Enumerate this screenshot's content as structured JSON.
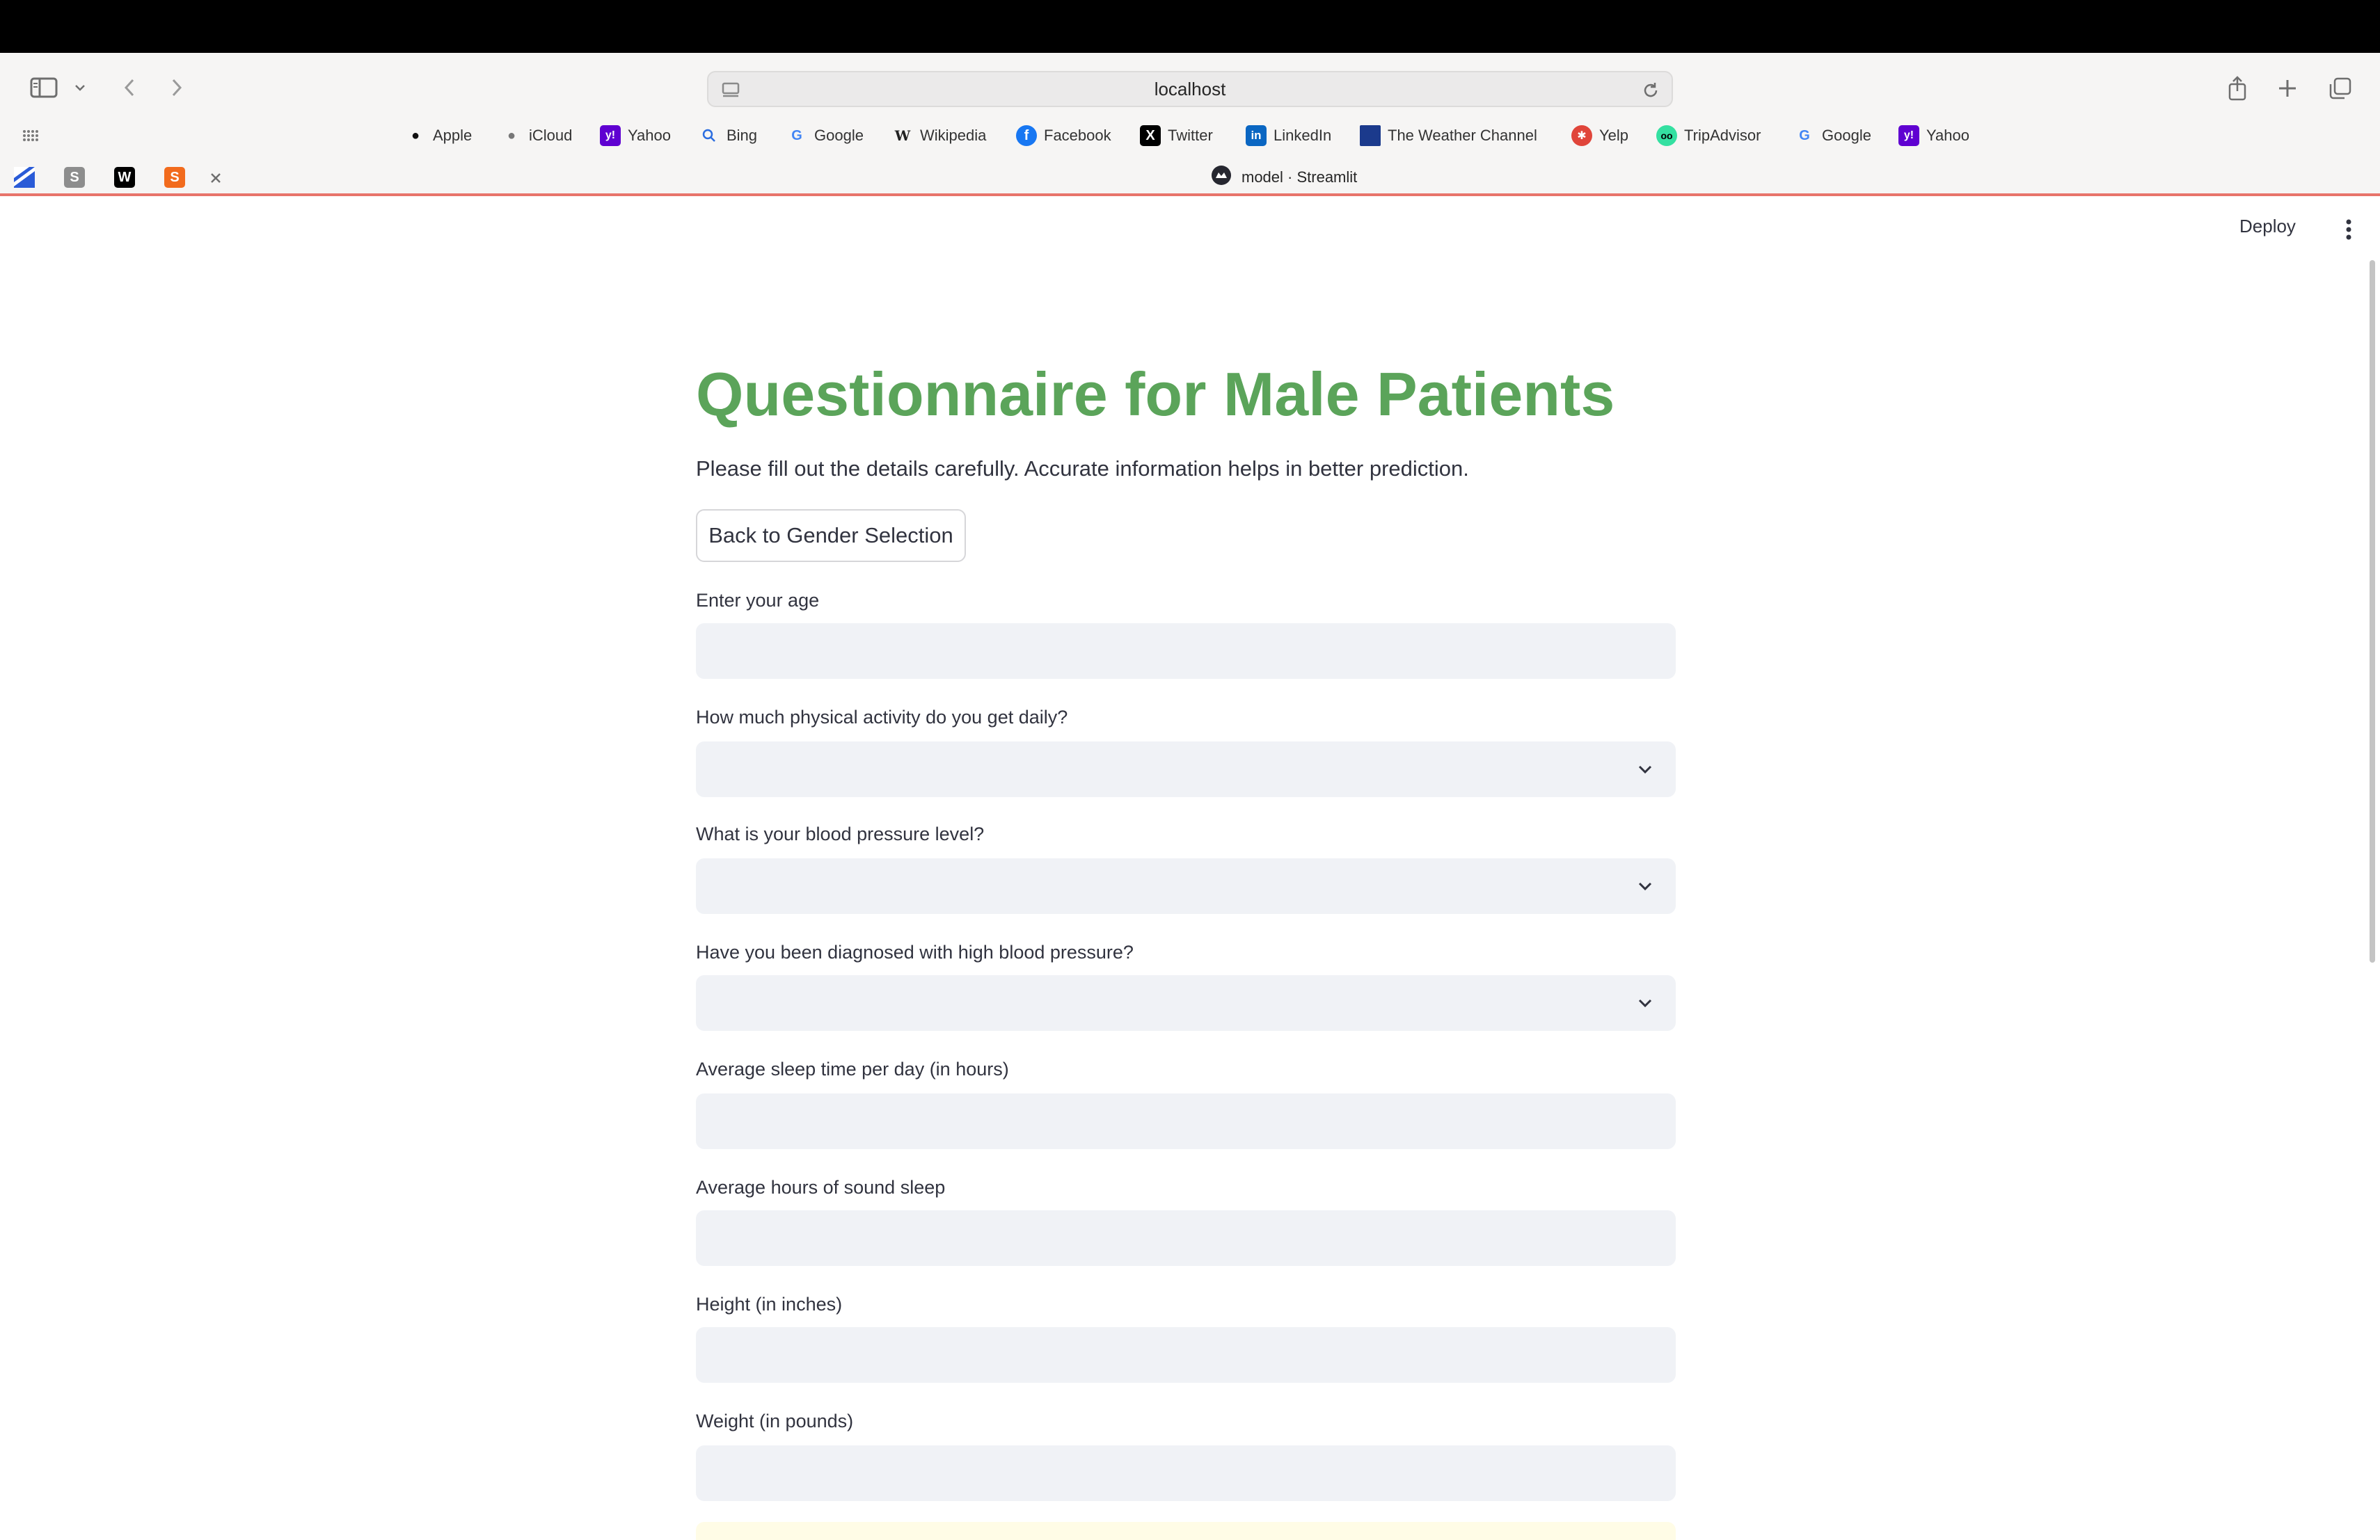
{
  "browser": {
    "url": "localhost",
    "tab_title": "model · Streamlit",
    "bookmarks": [
      {
        "label": "Apple",
        "icon": "apple-icon"
      },
      {
        "label": "iCloud",
        "icon": "apple-icon"
      },
      {
        "label": "Yahoo",
        "icon": "yahoo-icon"
      },
      {
        "label": "Bing",
        "icon": "bing-search-icon"
      },
      {
        "label": "Google",
        "icon": "google-icon"
      },
      {
        "label": "Wikipedia",
        "icon": "wikipedia-icon"
      },
      {
        "label": "Facebook",
        "icon": "facebook-icon"
      },
      {
        "label": "Twitter",
        "icon": "x-icon"
      },
      {
        "label": "LinkedIn",
        "icon": "linkedin-icon"
      },
      {
        "label": "The Weather Channel",
        "icon": "weather-channel-icon"
      },
      {
        "label": "Yelp",
        "icon": "yelp-icon"
      },
      {
        "label": "TripAdvisor",
        "icon": "tripadvisor-icon"
      },
      {
        "label": "Google",
        "icon": "google-icon"
      },
      {
        "label": "Yahoo",
        "icon": "yahoo-icon"
      }
    ],
    "accent_color": "#e8746a"
  },
  "app": {
    "deploy_label": "Deploy",
    "title": "Questionnaire for Male Patients",
    "title_color": "#5ba45a",
    "subtitle": "Please fill out the details carefully. Accurate information helps in better prediction.",
    "back_button": "Back to Gender Selection",
    "fields": {
      "age": {
        "label": "Enter your age",
        "value": ""
      },
      "physical_activity": {
        "label": "How much physical activity do you get daily?",
        "value": ""
      },
      "bp_level": {
        "label": "What is your blood pressure level?",
        "value": ""
      },
      "high_bp": {
        "label": "Have you been diagnosed with high blood pressure?",
        "value": ""
      },
      "sleep_time": {
        "label": "Average sleep time per day (in hours)",
        "value": ""
      },
      "sound_sleep": {
        "label": "Average hours of sound sleep",
        "value": ""
      },
      "height": {
        "label": "Height (in inches)",
        "value": ""
      },
      "weight": {
        "label": "Weight (in pounds)",
        "value": ""
      }
    }
  }
}
